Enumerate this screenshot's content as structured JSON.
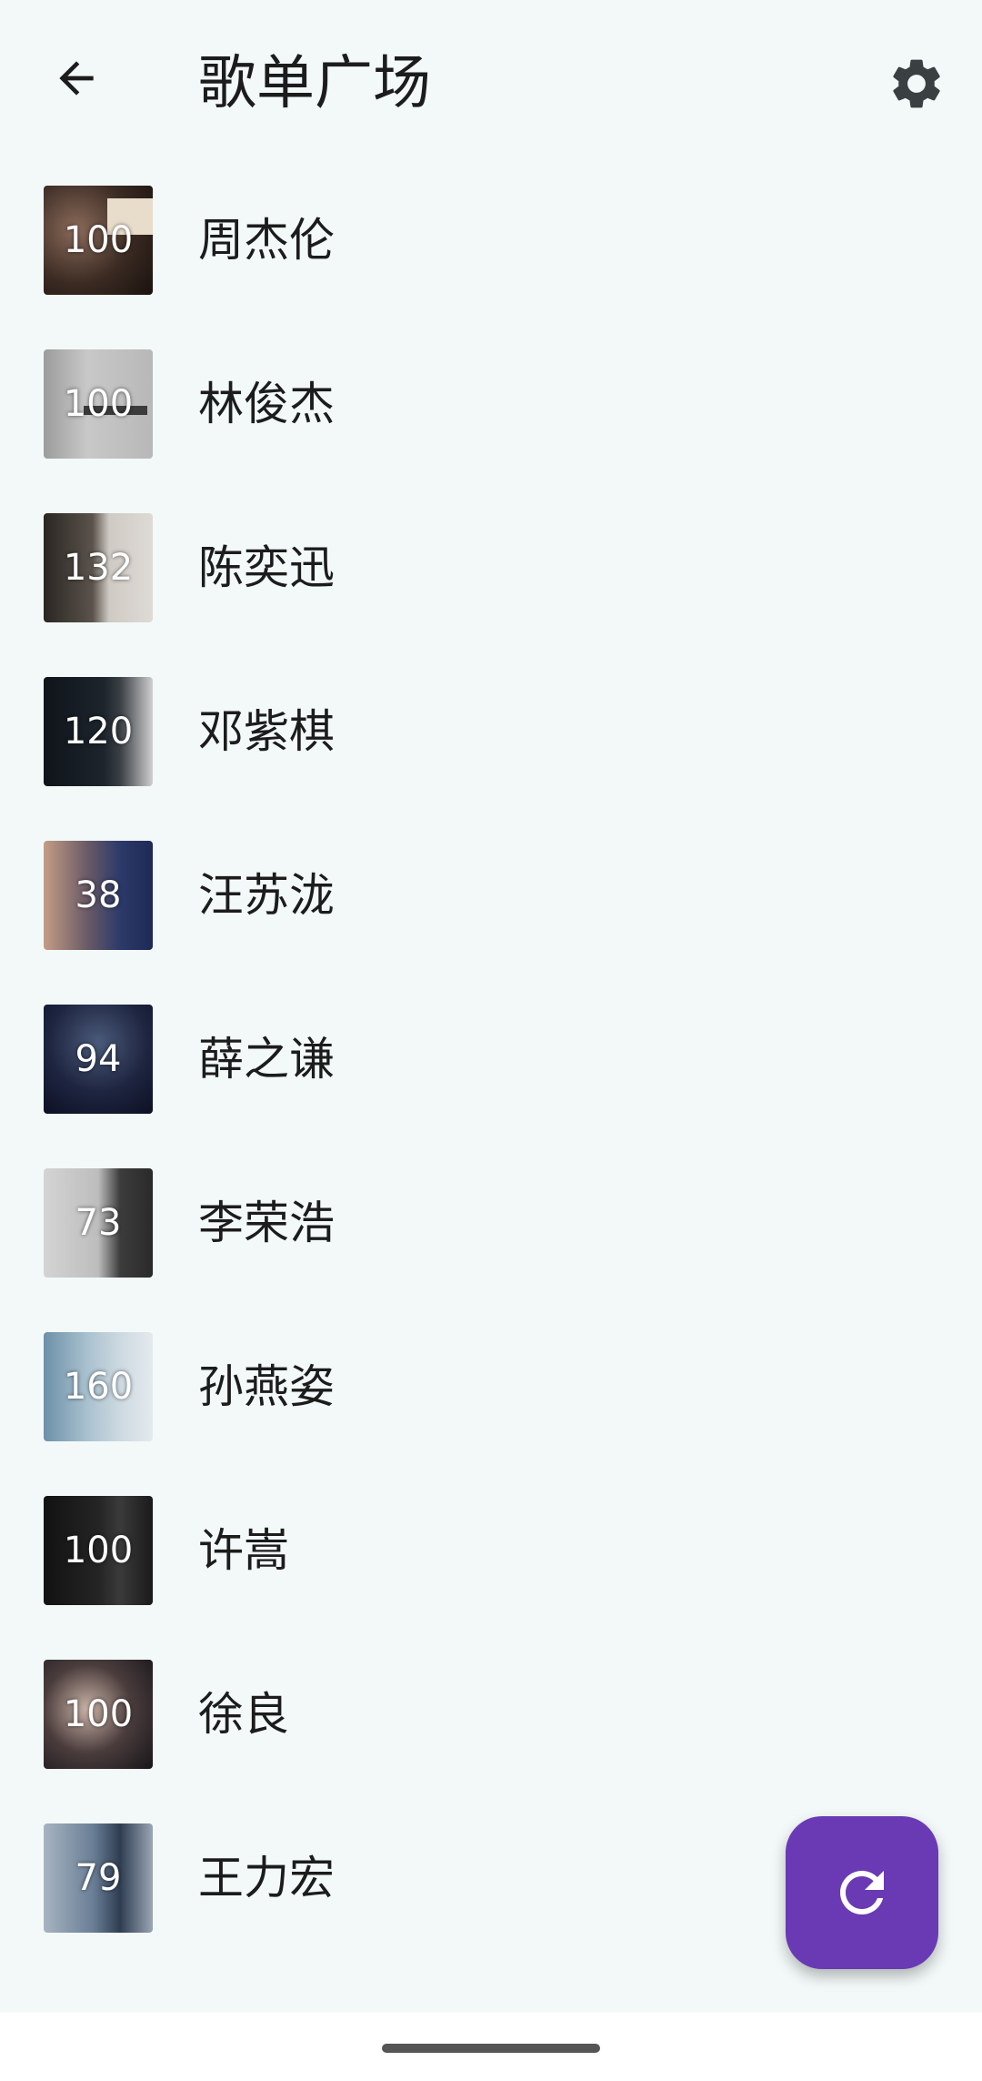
{
  "header": {
    "title": "歌单广场",
    "back_icon": "arrow-left-icon",
    "settings_icon": "gear-icon"
  },
  "playlists": [
    {
      "name": "周杰伦",
      "count": "100"
    },
    {
      "name": "林俊杰",
      "count": "100"
    },
    {
      "name": "陈奕迅",
      "count": "132"
    },
    {
      "name": "邓紫棋",
      "count": "120"
    },
    {
      "name": "汪苏泷",
      "count": "38"
    },
    {
      "name": "薛之谦",
      "count": "94"
    },
    {
      "name": "李荣浩",
      "count": "73"
    },
    {
      "name": "孙燕姿",
      "count": "160"
    },
    {
      "name": "许嵩",
      "count": "100"
    },
    {
      "name": "徐良",
      "count": "100"
    },
    {
      "name": "王力宏",
      "count": "79"
    }
  ],
  "fab": {
    "icon": "refresh-icon",
    "color": "#6a3ab4"
  }
}
